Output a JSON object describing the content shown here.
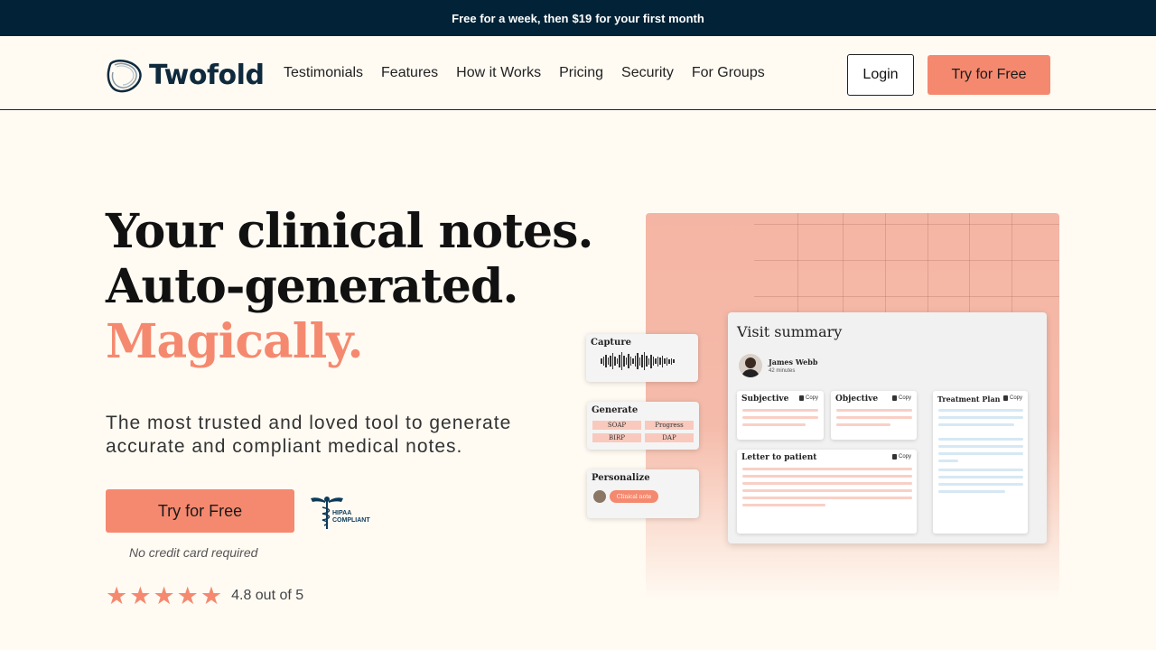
{
  "promo": {
    "prefix": "Free for a week, then",
    "price": "$19",
    "suffix": "for your first month"
  },
  "nav": {
    "brand": "Twofold",
    "links": [
      "Testimonials",
      "Features",
      "How it Works",
      "Pricing",
      "Security",
      "For Groups"
    ],
    "login_label": "Login",
    "try_label": "Try for Free"
  },
  "hero": {
    "line1": "Your clinical notes.",
    "line2": "Auto-generated.",
    "line3": "Magically.",
    "subtitle": "The most trusted and loved tool to generate accurate and compliant medical notes.",
    "cta_label": "Try for Free",
    "cta_note": "No credit card required",
    "hipaa_line1": "HIPAA",
    "hipaa_line2": "COMPLIANT",
    "rating_value": 4.8,
    "rating_text": "4.8 out of 5"
  },
  "illustration": {
    "capture_title": "Capture",
    "generate_title": "Generate",
    "generate_chips": [
      "SOAP",
      "Progress",
      "BIRP",
      "DAP"
    ],
    "personalize_title": "Personalize",
    "personalize_pill": "Clinical note",
    "visit_title": "Visit summary",
    "patient_name": "James Webb",
    "patient_duration": "42 minutes",
    "sections": {
      "subjective": "Subjective",
      "objective": "Objective",
      "treatment": "Treatment Plan",
      "letter": "Letter to patient"
    },
    "copy_label": "Copy"
  },
  "colors": {
    "accent": "#F5896F",
    "promo_bg": "#022237",
    "page_bg": "#FFFBF3"
  }
}
